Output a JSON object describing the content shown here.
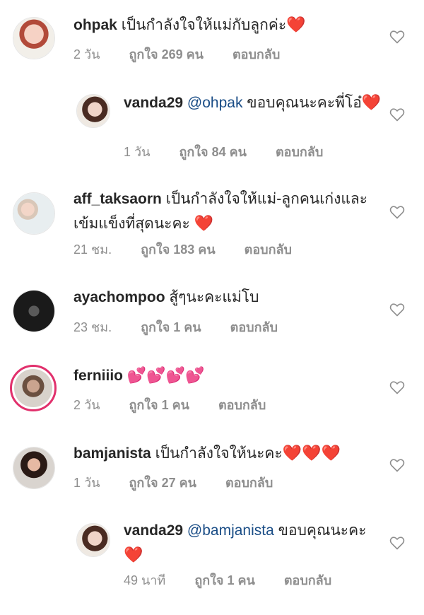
{
  "comments": [
    {
      "username": "ohpak",
      "mention": "",
      "text": "เป็นกำลังใจให้แม่กับลูกค่ะ",
      "emoji": "❤️",
      "time": "2 วัน",
      "likes": "ถูกใจ 269 คน",
      "reply": "ตอบกลับ"
    },
    {
      "username": "vanda29",
      "mention": "@ohpak",
      "text": "ขอบคุณนะคะพี่โอ๋",
      "emoji": "❤️",
      "time": "1 วัน",
      "likes": "ถูกใจ 84 คน",
      "reply": "ตอบกลับ"
    },
    {
      "username": "aff_taksaorn",
      "mention": "",
      "text": "เป็นกำลังใจให้แม่-ลูกคนเก่งและเข้มแข็งที่สุดนะคะ",
      "emoji": "❤️",
      "time": "21 ชม.",
      "likes": "ถูกใจ 183 คน",
      "reply": "ตอบกลับ"
    },
    {
      "username": "ayachompoo",
      "mention": "",
      "text": "สู้ๆนะคะแม่โบ",
      "emoji": "",
      "time": "23 ชม.",
      "likes": "ถูกใจ 1 คน",
      "reply": "ตอบกลับ"
    },
    {
      "username": "ferniiio",
      "mention": "",
      "text": "",
      "emoji": "💕💕💕💕",
      "time": "2 วัน",
      "likes": "ถูกใจ 1 คน",
      "reply": "ตอบกลับ"
    },
    {
      "username": "bamjanista",
      "mention": "",
      "text": "เป็นกำลังใจให้นะคะ",
      "emoji": "❤️❤️❤️",
      "time": "1 วัน",
      "likes": "ถูกใจ 27 คน",
      "reply": "ตอบกลับ"
    },
    {
      "username": "vanda29",
      "mention": "@bamjanista",
      "text": "ขอบคุณนะคะ",
      "emoji": "❤️",
      "time": "49 นาที",
      "likes": "ถูกใจ 1 คน",
      "reply": "ตอบกลับ"
    }
  ],
  "icons": {
    "like": "heart-outline-icon"
  },
  "colors": {
    "username": "#262626",
    "mention": "#1a4d86",
    "meta": "#8e8e8e",
    "story_ring": "#e1306c"
  }
}
